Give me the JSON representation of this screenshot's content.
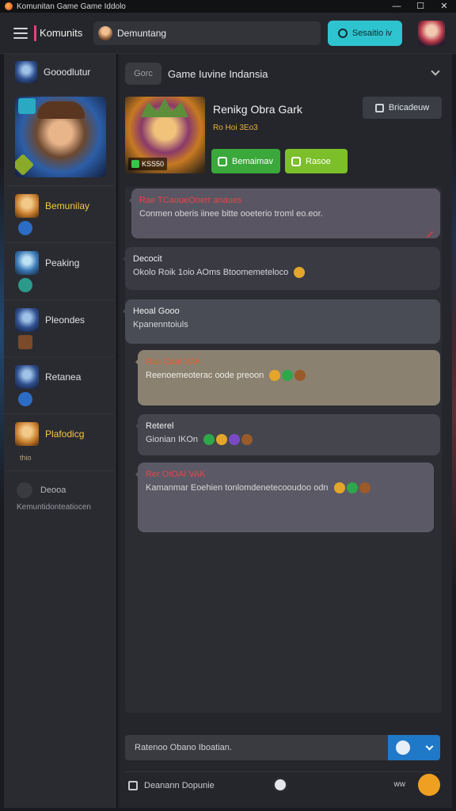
{
  "window": {
    "title": "Komunitan Game  Game  Iddolo",
    "controls": [
      "—",
      "☐",
      "✕"
    ]
  },
  "header": {
    "brand": "Komunits",
    "search_value": "Demuntang",
    "action_label": "Sesaitio iv"
  },
  "sidebar": {
    "top_label": "Gooodlutur",
    "items": [
      {
        "label": "Bemunilay",
        "active": true
      },
      {
        "label": "Peaking"
      },
      {
        "label": "Pleondes"
      },
      {
        "label": "Retanea"
      },
      {
        "label": "Plafodicg",
        "sub": "thio"
      }
    ],
    "bottom": {
      "label": "Deooa",
      "sub": "Kemuntidonteatiocen"
    }
  },
  "main": {
    "breadcrumb_chip": "Gorc",
    "breadcrumb_title": "Game Iuvine Indansia",
    "profile": {
      "name": "Renikg Obra Gark",
      "meta": "Ro Hoi 3Eo3",
      "tag": "KSS50",
      "btn1": "Bemaimav",
      "btn2": "Rasoe",
      "right_btn": "Bricadeuw"
    },
    "messages": [
      {
        "head": "Rae TCaoueOnerr anaues",
        "body": "Conmen oberis iinee bitte ooeterio troml eo.eor."
      },
      {
        "head": "Decocit",
        "body": "Okolo  Roik  1oio  AOms  Btoomemeteloco"
      },
      {
        "head": "Heoal Gooo",
        "body": "Kpanenntoiuls"
      },
      {
        "head": "Rac CabI VAK",
        "body": "Reenoemeoterac oode  preoon"
      },
      {
        "head": "Reterel",
        "body": "Gionian  IKOn"
      },
      {
        "head": "Rer OIOAI VAK",
        "body": "Kamanmar Eoehien  tonlomdenetecooudoo  odn"
      }
    ],
    "composer_placeholder": "Ratenoo Obano  Iboatian.",
    "footer_label": "Deanann Dopunie",
    "footer_right": "ww"
  }
}
